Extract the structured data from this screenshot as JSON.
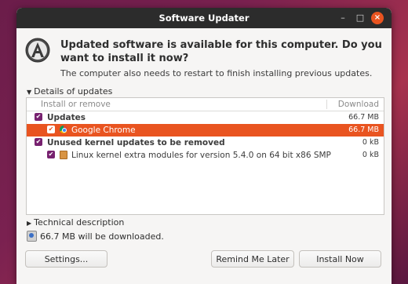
{
  "window": {
    "title": "Software Updater",
    "min_glyph": "–",
    "max_glyph": "□",
    "close_glyph": "×"
  },
  "header": {
    "headline": "Updated software is available for this computer. Do you want to install it now?",
    "subtext": "The computer also needs to restart to finish installing previous updates."
  },
  "details": {
    "expander_label": "Details of updates",
    "columns": {
      "install": "Install or remove",
      "download": "Download"
    },
    "updates_group": {
      "label": "Updates",
      "size": "66.7 MB"
    },
    "chrome": {
      "label": "Google Chrome",
      "size": "66.7 MB"
    },
    "kernel_group": {
      "label": "Unused kernel updates to be removed",
      "size": "0 kB"
    },
    "kernel_pkg": {
      "label": "Linux kernel extra modules for version 5.4.0 on 64 bit x86 SMP",
      "size": "0 kB"
    }
  },
  "technical": {
    "expander_label": "Technical description"
  },
  "download_info": {
    "text": "66.7 MB will be downloaded."
  },
  "buttons": {
    "settings": "Settings...",
    "remind": "Remind Me Later",
    "install": "Install Now"
  },
  "colors": {
    "accent": "#e95420",
    "checkbox": "#77216f",
    "titlebar": "#2c2c2c"
  }
}
